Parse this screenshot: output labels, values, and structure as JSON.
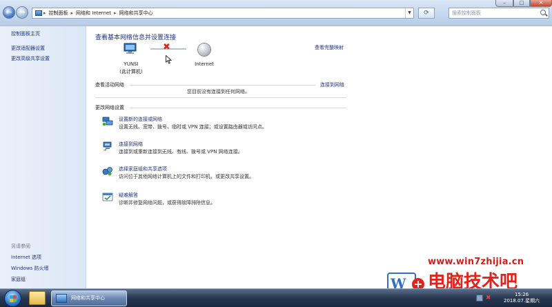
{
  "address_bar": {
    "breadcrumbs": [
      "控制面板",
      "网络和 Internet",
      "网络和共享中心"
    ],
    "search_placeholder": "搜索控制面板"
  },
  "window_controls": {
    "minimize": "–",
    "maximize": "□",
    "close": "✕"
  },
  "sidebar": {
    "items": [
      "控制面板主页",
      "更改适配器设置",
      "更改高级共享设置"
    ],
    "see_also_title": "另请参阅",
    "see_also": [
      "Internet 选项",
      "Windows 防火墙",
      "家庭组"
    ]
  },
  "main": {
    "heading": "查看基本网络信息并设置连接",
    "full_map_link": "查看完整映射",
    "network_map": {
      "computer_name": "YUNSI",
      "computer_sub": "(此计算机)",
      "internet_label": "Internet"
    },
    "active_networks": {
      "label": "查看活动网络",
      "connect_link": "连接到网络",
      "status": "您目前没有连接到任何网络。"
    },
    "change_settings": {
      "label": "更改网络设置",
      "tasks": [
        {
          "icon": "network-setup-icon",
          "title": "设置新的连接或网络",
          "desc": "设置无线、宽带、拨号、临时或 VPN 连接；或设置路由器或访问点。"
        },
        {
          "icon": "connect-network-icon",
          "title": "连接到网络",
          "desc": "连接到或重新连接到无线、有线、拨号或 VPN 网络连接。"
        },
        {
          "icon": "homegroup-sharing-icon",
          "title": "选择家庭组和共享选项",
          "desc": "访问位于其他网络计算机上的文件和打印机，或更改共享设置。"
        },
        {
          "icon": "troubleshoot-icon",
          "title": "疑难解答",
          "desc": "诊断并修复网络问题，或获得故障排除信息。"
        }
      ]
    }
  },
  "taskbar": {
    "active_task": "网络和共享中心",
    "clock_time": "15:26",
    "clock_date": "2018.07.星期六"
  },
  "watermark": {
    "url": "www.win7zhijia.cn",
    "brand": "电脑技术吧"
  },
  "colors": {
    "link": "#1e3287",
    "sidebar_bg": "#e3ecf8",
    "disconnect_x": "#d42a1e",
    "watermark_red": "#e0241c"
  }
}
